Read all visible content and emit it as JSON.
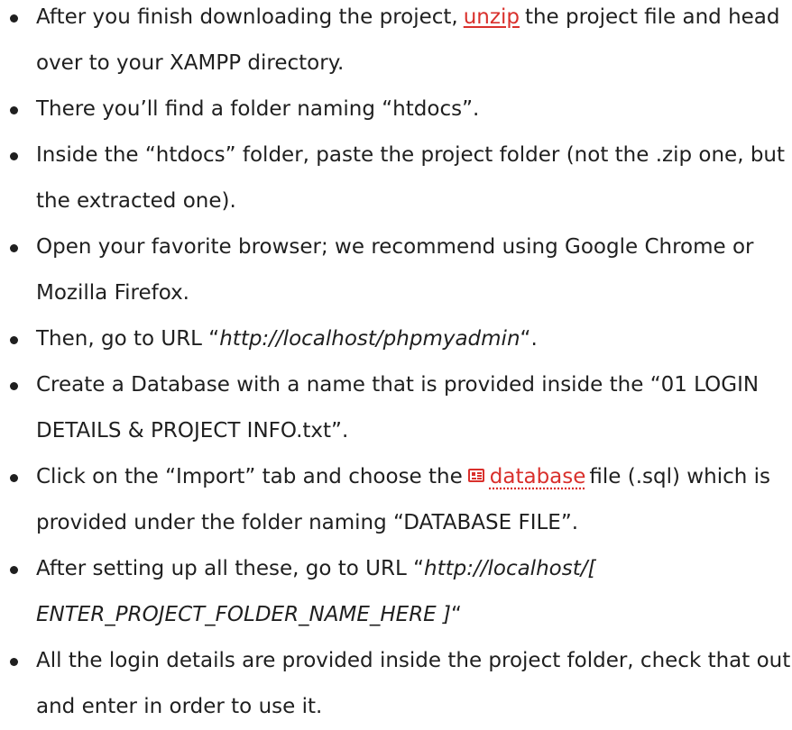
{
  "steps": [
    {
      "a": "After you finish downloading the project,",
      "link": "unzip",
      "b": "the project file and head over to your XAMPP directory."
    },
    {
      "text": "There you’ll find a folder naming “htdocs”."
    },
    {
      "text": "Inside the “htdocs” folder, paste the project folder (not the .zip one, but the extracted one)."
    },
    {
      "text": "Open your favorite browser; we recommend using Google Chrome or Mozilla Firefox."
    },
    {
      "a": "Then, go to URL “",
      "url": "http://localhost/phpmyadmin",
      "b": "“."
    },
    {
      "text": "Create a Database with a name that is provided inside the “01 LOGIN DETAILS & PROJECT INFO.txt”."
    },
    {
      "a": "Click on the “Import” tab and choose the",
      "icon": "document-icon",
      "link": "database",
      "b": "file (.sql) which is provided under the folder naming “DATABASE FILE”."
    },
    {
      "a": "After setting up all these, go to URL “",
      "url": "http://localhost/[ ENTER_PROJECT_FOLDER_NAME_HERE ]",
      "b": "“"
    },
    {
      "text": "All the login details are provided inside the project folder, check that out and enter in order to use it."
    }
  ],
  "colors": {
    "text": "#1f1f1f",
    "link": "#d9302c"
  }
}
